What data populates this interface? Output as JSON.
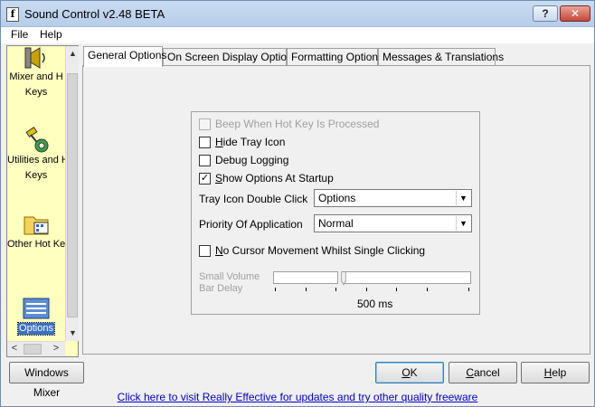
{
  "window": {
    "title": "Sound Control v2.48 BETA",
    "help_label": "?",
    "close_label": "✕"
  },
  "menu": {
    "items": [
      "File",
      "Help"
    ]
  },
  "left_panel": {
    "items": [
      {
        "label_line1": "Mixer and H",
        "label_line2": "Keys",
        "icon": "speaker-icon"
      },
      {
        "label_line1": "Utilities and H",
        "label_line2": "Keys",
        "icon": "utilities-icon"
      },
      {
        "label_line1": "Other Hot Ke",
        "label_line2": "",
        "icon": "folder-icon"
      },
      {
        "label_line1": "Options",
        "label_line2": "",
        "icon": "options-icon",
        "selected": true
      }
    ],
    "scroll_up": "▲",
    "scroll_down": "▼",
    "scroll_left": "<",
    "scroll_right": ">"
  },
  "tabs": [
    {
      "label": "General Options",
      "active": true
    },
    {
      "label": "On Screen Display Options"
    },
    {
      "label": "Formatting Options"
    },
    {
      "label": "Messages & Translations"
    }
  ],
  "options": {
    "beep": {
      "label": "Beep When Hot Key Is Processed",
      "checked": false,
      "enabled": false
    },
    "hide_tray": {
      "label_ul": "H",
      "label_rest": "ide Tray Icon",
      "checked": false
    },
    "debug": {
      "label": "Debug Logging",
      "checked": false
    },
    "show_startup": {
      "label_ul": "S",
      "label_rest": "how Options At Startup",
      "checked": true,
      "mark": "✓"
    },
    "tray_double_click": {
      "label": "Tray Icon Double Click",
      "value": "Options"
    },
    "priority": {
      "label": "Priority Of Application",
      "value": "Normal"
    },
    "no_cursor": {
      "label_ul": "N",
      "label_rest": "o Cursor Movement Whilst Single Clicking",
      "checked": false
    },
    "small_volume": {
      "label_line1": "Small Volume",
      "label_line2": "Bar Delay",
      "value_text": "500 ms",
      "level": 0.36
    },
    "dropdown_arrow": "▼"
  },
  "buttons": {
    "windows_mixer": "Windows Mixer",
    "ok_ul": "O",
    "ok_rest": "K",
    "cancel_ul": "C",
    "cancel_rest": "ancel",
    "help_ul": "H",
    "help_rest": "elp"
  },
  "footer": {
    "link_text": "Click here to visit Really Effective for updates and try other quality freeware",
    "link_color": "#0000cc"
  },
  "colors": {
    "left_panel_bg": "#ffffc0",
    "selection": "#3a6fc4",
    "close_button": "#c5473a"
  }
}
